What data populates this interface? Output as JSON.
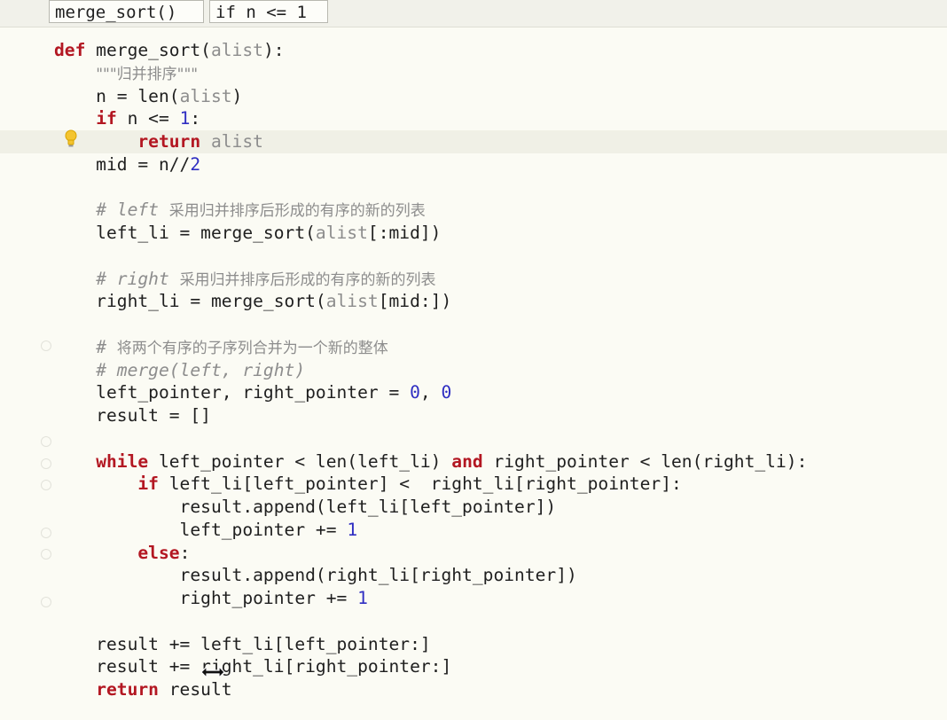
{
  "breadcrumb": {
    "items": [
      "merge_sort()",
      "if n <= 1"
    ]
  },
  "code": {
    "lines": [
      [
        {
          "t": "def",
          "c": "kw"
        },
        {
          "t": " merge_sort(",
          "c": "fn"
        },
        {
          "t": "alist",
          "c": "dim"
        },
        {
          "t": "):",
          "c": "fn"
        }
      ],
      [
        {
          "t": "    ",
          "c": "fn"
        },
        {
          "t": "\"\"\"归并排序\"\"\"",
          "c": "doc"
        }
      ],
      [
        {
          "t": "    n = len(",
          "c": "fn"
        },
        {
          "t": "alist",
          "c": "dim"
        },
        {
          "t": ")",
          "c": "fn"
        }
      ],
      [
        {
          "t": "    ",
          "c": "fn"
        },
        {
          "t": "if",
          "c": "kw"
        },
        {
          "t": " n <= ",
          "c": "fn"
        },
        {
          "t": "1",
          "c": "num"
        },
        {
          "t": ":",
          "c": "fn"
        }
      ],
      [
        {
          "t": "        ",
          "c": "fn"
        },
        {
          "t": "return",
          "c": "kw"
        },
        {
          "t": " ",
          "c": "fn"
        },
        {
          "t": "alist",
          "c": "dim"
        }
      ],
      [
        {
          "t": "    mid = n//",
          "c": "fn"
        },
        {
          "t": "2",
          "c": "num"
        }
      ],
      [],
      [
        {
          "t": "    ",
          "c": "fn"
        },
        {
          "t": "# left ",
          "c": "cm"
        },
        {
          "t": "采用归并排序后形成的有序的新的列表",
          "c": "cm-cn"
        }
      ],
      [
        {
          "t": "    left_li = merge_sort(",
          "c": "fn"
        },
        {
          "t": "alist",
          "c": "dim"
        },
        {
          "t": "[:mid])",
          "c": "fn"
        }
      ],
      [],
      [
        {
          "t": "    ",
          "c": "fn"
        },
        {
          "t": "# right ",
          "c": "cm"
        },
        {
          "t": "采用归并排序后形成的有序的新的列表",
          "c": "cm-cn"
        }
      ],
      [
        {
          "t": "    right_li = merge_sort(",
          "c": "fn"
        },
        {
          "t": "alist",
          "c": "dim"
        },
        {
          "t": "[mid:])",
          "c": "fn"
        }
      ],
      [],
      [
        {
          "t": "    ",
          "c": "fn"
        },
        {
          "t": "# ",
          "c": "cm"
        },
        {
          "t": "将两个有序的子序列合并为一个新的整体",
          "c": "cm-cn"
        }
      ],
      [
        {
          "t": "    ",
          "c": "fn"
        },
        {
          "t": "# merge(left, right)",
          "c": "cm"
        }
      ],
      [
        {
          "t": "    left_pointer, right_pointer = ",
          "c": "fn"
        },
        {
          "t": "0",
          "c": "num"
        },
        {
          "t": ", ",
          "c": "fn"
        },
        {
          "t": "0",
          "c": "num"
        }
      ],
      [
        {
          "t": "    result = []",
          "c": "fn"
        }
      ],
      [],
      [
        {
          "t": "    ",
          "c": "fn"
        },
        {
          "t": "while",
          "c": "kw"
        },
        {
          "t": " left_pointer < len(left_li) ",
          "c": "fn"
        },
        {
          "t": "and",
          "c": "kw"
        },
        {
          "t": " right_pointer < len(right_li):",
          "c": "fn"
        }
      ],
      [
        {
          "t": "        ",
          "c": "fn"
        },
        {
          "t": "if",
          "c": "kw"
        },
        {
          "t": " left_li[left_pointer] <  right_li[right_pointer]:",
          "c": "fn"
        }
      ],
      [
        {
          "t": "            result.append(left_li[left_pointer])",
          "c": "fn"
        }
      ],
      [
        {
          "t": "            left_pointer += ",
          "c": "fn"
        },
        {
          "t": "1",
          "c": "num"
        }
      ],
      [
        {
          "t": "        ",
          "c": "fn"
        },
        {
          "t": "else",
          "c": "kw"
        },
        {
          "t": ":",
          "c": "fn"
        }
      ],
      [
        {
          "t": "            result.append(right_li[right_pointer])",
          "c": "fn"
        }
      ],
      [
        {
          "t": "            right_pointer += ",
          "c": "fn"
        },
        {
          "t": "1",
          "c": "num"
        }
      ],
      [],
      [
        {
          "t": "    result += left_li[left_pointer:]",
          "c": "fn"
        }
      ],
      [
        {
          "t": "    result += right_li[right_pointer:]",
          "c": "fn"
        }
      ],
      [
        {
          "t": "    ",
          "c": "fn"
        },
        {
          "t": "return",
          "c": "kw"
        },
        {
          "t": " result",
          "c": "fn"
        }
      ]
    ],
    "current_line_index": 4
  }
}
